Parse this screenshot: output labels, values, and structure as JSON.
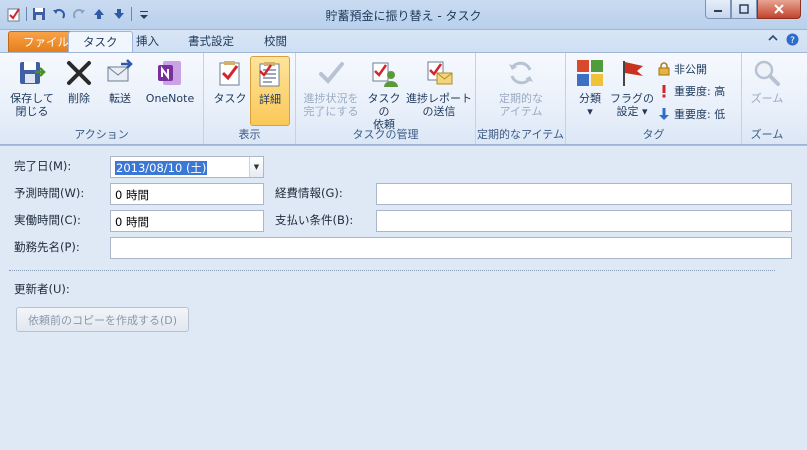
{
  "window": {
    "title": "貯蓄預金に振り替え - タスク"
  },
  "tabs": {
    "file": "ファイル",
    "task": "タスク",
    "insert": "挿入",
    "format": "書式設定",
    "review": "校閲"
  },
  "ribbon": {
    "action": {
      "label": "アクション",
      "save_close": [
        "保存して",
        "閉じる"
      ],
      "delete": "削除",
      "forward": "転送",
      "onenote": "OneNote"
    },
    "show": {
      "label": "表示",
      "task": "タスク",
      "details": "詳細"
    },
    "manage": {
      "label": "タスクの管理",
      "mark_complete": [
        "進捗状況を",
        "完了にする"
      ],
      "assign": [
        "タスクの",
        "依頼"
      ],
      "send_status": [
        "進捗レポート",
        "の送信"
      ]
    },
    "recurrence": {
      "label": "定期的なアイテム",
      "recurrence": [
        "定期的な",
        "アイテム"
      ]
    },
    "tags": {
      "label": "タグ",
      "categorize": "分類",
      "followup": [
        "フラグの",
        "設定"
      ],
      "private": "非公開",
      "high": "重要度: 高",
      "low": "重要度: 低"
    },
    "zoom": {
      "label": "ズーム",
      "zoom": "ズーム"
    }
  },
  "form": {
    "date_completed_label": "完了日(M):",
    "date_completed_value": "2013/08/10 (土)",
    "total_work_label": "予測時間(W):",
    "total_work_value": "0 時間",
    "actual_work_label": "実働時間(C):",
    "actual_work_value": "0 時間",
    "company_label": "勤務先名(P):",
    "company_value": "",
    "mileage_label": "経費情報(G):",
    "mileage_value": "",
    "billing_label": "支払い条件(B):",
    "billing_value": "",
    "updated_by_label": "更新者(U):",
    "create_copy_button": "依頼前のコピーを作成する(D)"
  },
  "colors": {
    "accent_file_tab": "#e67e1a",
    "selected_button": "#fbc858"
  }
}
